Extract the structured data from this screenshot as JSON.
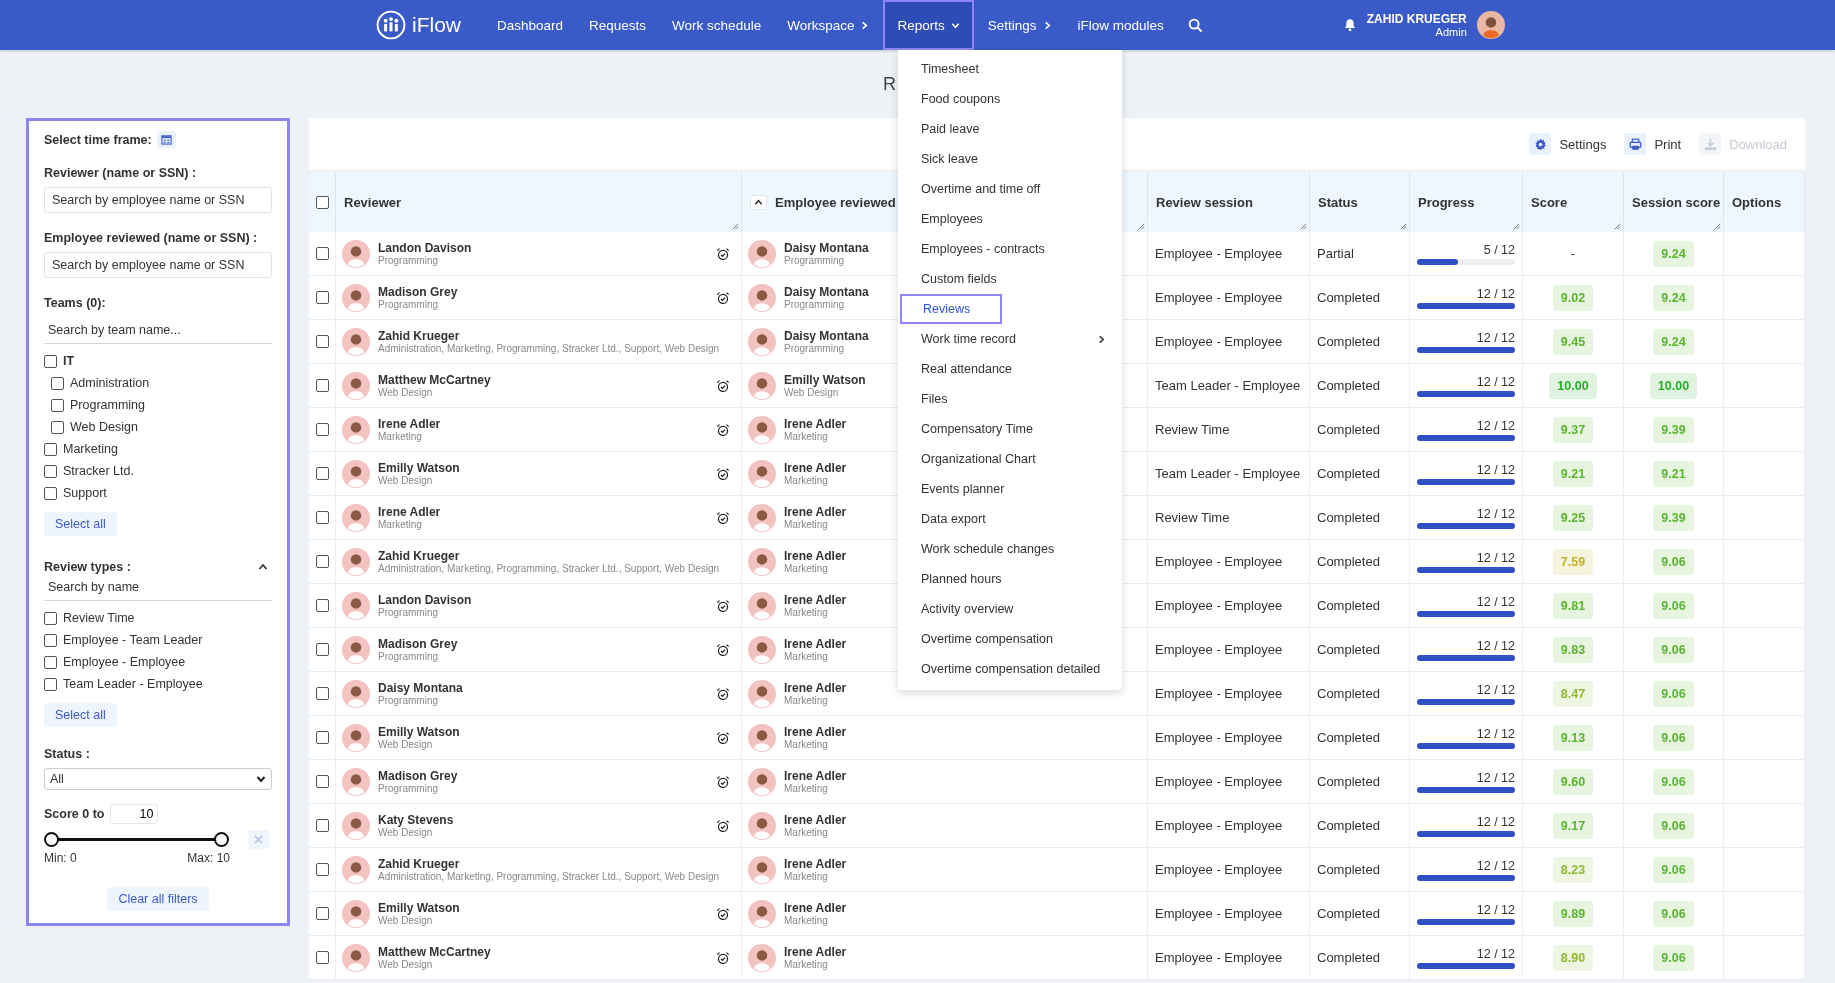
{
  "nav": {
    "brand": "iFlow",
    "items": [
      {
        "label": "Dashboard",
        "selected": false
      },
      {
        "label": "Requests",
        "selected": false
      },
      {
        "label": "Work schedule",
        "selected": false
      },
      {
        "label": "Workspace",
        "selected": false,
        "kind": "submenu"
      },
      {
        "label": "Reports",
        "selected": true,
        "kind": "dropdown"
      },
      {
        "label": "Settings",
        "selected": false,
        "kind": "submenu"
      },
      {
        "label": "iFlow modules",
        "selected": false
      }
    ],
    "user": {
      "name": "ZAHID KRUEGER",
      "role": "Admin"
    }
  },
  "reports_menu": [
    {
      "label": "Timesheet",
      "selected": false
    },
    {
      "label": "Food coupons",
      "selected": false
    },
    {
      "label": "Paid leave",
      "selected": false
    },
    {
      "label": "Sick leave",
      "selected": false
    },
    {
      "label": "Overtime and time off",
      "selected": false
    },
    {
      "label": "Employees",
      "selected": false
    },
    {
      "label": "Employees - contracts",
      "selected": false
    },
    {
      "label": "Custom fields",
      "selected": false
    },
    {
      "label": "Reviews",
      "selected": true
    },
    {
      "label": "Work time record",
      "selected": false,
      "submenu": true
    },
    {
      "label": "Real attendance",
      "selected": false
    },
    {
      "label": "Files",
      "selected": false
    },
    {
      "label": "Compensatory Time",
      "selected": false
    },
    {
      "label": "Organizational Chart",
      "selected": false
    },
    {
      "label": "Events planner",
      "selected": false
    },
    {
      "label": "Data export",
      "selected": false
    },
    {
      "label": "Work schedule changes",
      "selected": false
    },
    {
      "label": "Planned hours",
      "selected": false
    },
    {
      "label": "Activity overview",
      "selected": false
    },
    {
      "label": "Overtime compensation",
      "selected": false
    },
    {
      "label": "Overtime compensation detailed",
      "selected": false
    }
  ],
  "page_title": "R",
  "filters": {
    "time_frame_label": "Select time frame:",
    "reviewer": {
      "label": "Reviewer (name or SSN) :",
      "placeholder": "Search by employee name or SSN"
    },
    "employee_reviewed": {
      "label": "Employee reviewed (name or SSN) :",
      "placeholder": "Search by employee name or SSN"
    },
    "teams": {
      "label": "Teams (0):",
      "placeholder": "Search by team name...",
      "items": [
        {
          "label": "IT",
          "checked": false,
          "children": [
            {
              "label": "Administration",
              "checked": false
            },
            {
              "label": "Programming",
              "checked": false
            },
            {
              "label": "Web Design",
              "checked": false
            }
          ]
        },
        {
          "label": "Marketing",
          "checked": false
        },
        {
          "label": "Stracker Ltd.",
          "checked": false
        },
        {
          "label": "Support",
          "checked": false
        }
      ],
      "select_all": "Select all"
    },
    "review_types": {
      "label": "Review types :",
      "expanded": true,
      "placeholder": "Search by name",
      "items": [
        {
          "label": "Review Time",
          "checked": false
        },
        {
          "label": "Employee - Team Leader",
          "checked": false
        },
        {
          "label": "Employee - Employee",
          "checked": false
        },
        {
          "label": "Team Leader - Employee",
          "checked": false
        }
      ],
      "select_all": "Select all"
    },
    "status": {
      "label": "Status :",
      "value": "All"
    },
    "score": {
      "label": "Score 0 to",
      "value": "10",
      "thumbs": [
        {
          "level": 0
        },
        {
          "level": 1
        }
      ],
      "min_label": "Min: 0",
      "max_label": "Max: 10"
    },
    "clear_all": "Clear all filters"
  },
  "toolbar": [
    {
      "label": "Settings",
      "disabled": false
    },
    {
      "label": "Print",
      "disabled": false
    },
    {
      "label": "Download",
      "disabled": true
    }
  ],
  "table": {
    "select_all_checked": false,
    "columns": [
      "Reviewer",
      "Employee reviewed",
      "Review session",
      "Status",
      "Progress",
      "Score",
      "Session score",
      "Options"
    ],
    "rows": [
      {
        "checked": false,
        "reviewer": "Landon Davison",
        "reviewer_team": "Programming",
        "reminder": true,
        "employee": "Daisy Montana",
        "employee_team": "Programming",
        "session": "Employee - Employee",
        "status": "Partial",
        "progress": "5 / 12",
        "level": 0.42,
        "score": {
          "text": "-"
        },
        "session_score": {
          "text": "9.24",
          "color": "#5cb531"
        }
      },
      {
        "checked": false,
        "reviewer": "Madison Grey",
        "reviewer_team": "Programming",
        "reminder": true,
        "employee": "Daisy Montana",
        "employee_team": "Programming",
        "session": "Employee - Employee",
        "status": "Completed",
        "progress": "12 / 12",
        "level": 1,
        "score": {
          "text": "9.02",
          "color": "#5cb531"
        },
        "session_score": {
          "text": "9.24",
          "color": "#5cb531"
        }
      },
      {
        "checked": false,
        "reviewer": "Zahid Krueger",
        "reviewer_team": "Administration, Marketing, Programming, Stracker Ltd., Support, Web Design",
        "reminder": false,
        "employee": "Daisy Montana",
        "employee_team": "Programming",
        "session": "Employee - Employee",
        "status": "Completed",
        "progress": "12 / 12",
        "level": 1,
        "score": {
          "text": "9.45",
          "color": "#5cb531"
        },
        "session_score": {
          "text": "9.24",
          "color": "#5cb531"
        }
      },
      {
        "checked": false,
        "reviewer": "Matthew McCartney",
        "reviewer_team": "Web Design",
        "reminder": true,
        "employee": "Emilly Watson",
        "employee_team": "Web Design",
        "session": "Team Leader - Employee",
        "status": "Completed",
        "progress": "12 / 12",
        "level": 1,
        "score": {
          "text": "10.00",
          "color": "#2aae2a"
        },
        "session_score": {
          "text": "10.00",
          "color": "#2aae2a"
        }
      },
      {
        "checked": false,
        "reviewer": "Irene Adler",
        "reviewer_team": "Marketing",
        "reminder": true,
        "employee": "Irene Adler",
        "employee_team": "Marketing",
        "session": "Review Time",
        "status": "Completed",
        "progress": "12 / 12",
        "level": 1,
        "score": {
          "text": "9.37",
          "color": "#5cb531"
        },
        "session_score": {
          "text": "9.39",
          "color": "#5cb531"
        }
      },
      {
        "checked": false,
        "reviewer": "Emilly Watson",
        "reviewer_team": "Web Design",
        "reminder": true,
        "employee": "Irene Adler",
        "employee_team": "Marketing",
        "session": "Team Leader - Employee",
        "status": "Completed",
        "progress": "12 / 12",
        "level": 1,
        "score": {
          "text": "9.21",
          "color": "#5cb531"
        },
        "session_score": {
          "text": "9.21",
          "color": "#5cb531"
        }
      },
      {
        "checked": false,
        "reviewer": "Irene Adler",
        "reviewer_team": "Marketing",
        "reminder": true,
        "employee": "Irene Adler",
        "employee_team": "Marketing",
        "session": "Review Time",
        "status": "Completed",
        "progress": "12 / 12",
        "level": 1,
        "score": {
          "text": "9.25",
          "color": "#5cb531"
        },
        "session_score": {
          "text": "9.39",
          "color": "#5cb531"
        }
      },
      {
        "checked": false,
        "reviewer": "Zahid Krueger",
        "reviewer_team": "Administration, Marketing, Programming, Stracker Ltd., Support, Web Design",
        "reminder": false,
        "employee": "Irene Adler",
        "employee_team": "Marketing",
        "session": "Employee - Employee",
        "status": "Completed",
        "progress": "12 / 12",
        "level": 1,
        "score": {
          "text": "7.59",
          "color": "#c4b02a"
        },
        "session_score": {
          "text": "9.06",
          "color": "#5cb531"
        }
      },
      {
        "checked": false,
        "reviewer": "Landon Davison",
        "reviewer_team": "Programming",
        "reminder": true,
        "employee": "Irene Adler",
        "employee_team": "Marketing",
        "session": "Employee - Employee",
        "status": "Completed",
        "progress": "12 / 12",
        "level": 1,
        "score": {
          "text": "9.81",
          "color": "#5cb531"
        },
        "session_score": {
          "text": "9.06",
          "color": "#5cb531"
        }
      },
      {
        "checked": false,
        "reviewer": "Madison Grey",
        "reviewer_team": "Programming",
        "reminder": true,
        "employee": "Irene Adler",
        "employee_team": "Marketing",
        "session": "Employee - Employee",
        "status": "Completed",
        "progress": "12 / 12",
        "level": 1,
        "score": {
          "text": "9.83",
          "color": "#5cb531"
        },
        "session_score": {
          "text": "9.06",
          "color": "#5cb531"
        }
      },
      {
        "checked": false,
        "reviewer": "Daisy Montana",
        "reviewer_team": "Programming",
        "reminder": true,
        "employee": "Irene Adler",
        "employee_team": "Marketing",
        "session": "Employee - Employee",
        "status": "Completed",
        "progress": "12 / 12",
        "level": 1,
        "score": {
          "text": "8.47",
          "color": "#8fba35"
        },
        "session_score": {
          "text": "9.06",
          "color": "#5cb531"
        }
      },
      {
        "checked": false,
        "reviewer": "Emilly Watson",
        "reviewer_team": "Web Design",
        "reminder": true,
        "employee": "Irene Adler",
        "employee_team": "Marketing",
        "session": "Employee - Employee",
        "status": "Completed",
        "progress": "12 / 12",
        "level": 1,
        "score": {
          "text": "9.13",
          "color": "#5cb531"
        },
        "session_score": {
          "text": "9.06",
          "color": "#5cb531"
        }
      },
      {
        "checked": false,
        "reviewer": "Madison Grey",
        "reviewer_team": "Programming",
        "reminder": true,
        "employee": "Irene Adler",
        "employee_team": "Marketing",
        "session": "Employee - Employee",
        "status": "Completed",
        "progress": "12 / 12",
        "level": 1,
        "score": {
          "text": "9.60",
          "color": "#5cb531"
        },
        "session_score": {
          "text": "9.06",
          "color": "#5cb531"
        }
      },
      {
        "checked": false,
        "reviewer": "Katy Stevens",
        "reviewer_team": "Web Design",
        "reminder": true,
        "employee": "Irene Adler",
        "employee_team": "Marketing",
        "session": "Employee - Employee",
        "status": "Completed",
        "progress": "12 / 12",
        "level": 1,
        "score": {
          "text": "9.17",
          "color": "#5cb531"
        },
        "session_score": {
          "text": "9.06",
          "color": "#5cb531"
        }
      },
      {
        "checked": false,
        "reviewer": "Zahid Krueger",
        "reviewer_team": "Administration, Marketing, Programming, Stracker Ltd., Support, Web Design",
        "reminder": false,
        "employee": "Irene Adler",
        "employee_team": "Marketing",
        "session": "Employee - Employee",
        "status": "Completed",
        "progress": "12 / 12",
        "level": 1,
        "score": {
          "text": "8.23",
          "color": "#8fba35"
        },
        "session_score": {
          "text": "9.06",
          "color": "#5cb531"
        }
      },
      {
        "checked": false,
        "reviewer": "Emilly Watson",
        "reviewer_team": "Web Design",
        "reminder": true,
        "employee": "Irene Adler",
        "employee_team": "Marketing",
        "session": "Employee - Employee",
        "status": "Completed",
        "progress": "12 / 12",
        "level": 1,
        "score": {
          "text": "9.89",
          "color": "#5cb531"
        },
        "session_score": {
          "text": "9.06",
          "color": "#5cb531"
        }
      },
      {
        "checked": false,
        "reviewer": "Matthew McCartney",
        "reviewer_team": "Web Design",
        "reminder": true,
        "employee": "Irene Adler",
        "employee_team": "Marketing",
        "session": "Employee - Employee",
        "status": "Completed",
        "progress": "12 / 12",
        "level": 1,
        "score": {
          "text": "8.90",
          "color": "#8fba35"
        },
        "session_score": {
          "text": "9.06",
          "color": "#5cb531"
        }
      }
    ]
  }
}
